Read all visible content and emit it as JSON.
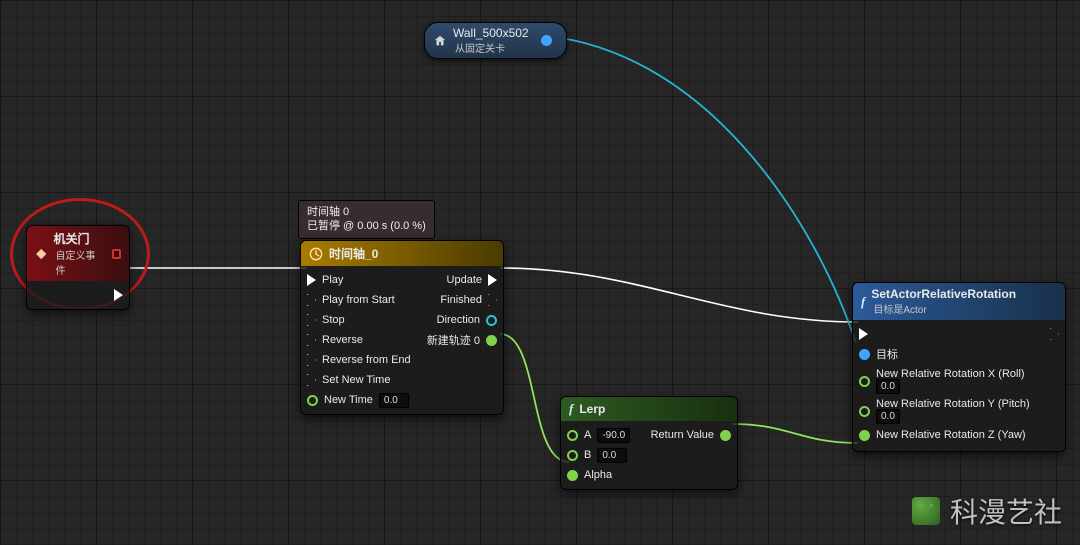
{
  "colors": {
    "exec_wire": "#ffffff",
    "float_wire": "#8fe35a",
    "object_wire": "#26b3d4"
  },
  "wall_ref": {
    "title": "Wall_500x502",
    "subtitle": "从固定关卡"
  },
  "red_annotation": true,
  "custom_event": {
    "title": "机关门",
    "subtitle": "自定义事件"
  },
  "timeline_tooltip": {
    "line1": "时间轴 0",
    "line2": "已暂停 @ 0.00 s (0.0 %)"
  },
  "timeline": {
    "title": "时间轴_0",
    "inputs": {
      "play": "Play",
      "play_from_start": "Play from Start",
      "stop": "Stop",
      "reverse": "Reverse",
      "reverse_from_end": "Reverse from End",
      "set_new_time": "Set New Time",
      "new_time": "New Time",
      "new_time_value": "0.0"
    },
    "outputs": {
      "update": "Update",
      "finished": "Finished",
      "direction": "Direction",
      "track0": "新建轨迹 0"
    }
  },
  "lerp": {
    "title": "Lerp",
    "a_label": "A",
    "a_value": "-90.0",
    "b_label": "B",
    "b_value": "0.0",
    "alpha_label": "Alpha",
    "return_label": "Return Value"
  },
  "set_rot": {
    "title": "SetActorRelativeRotation",
    "subtitle": "目标是Actor",
    "target_label": "目标",
    "roll_label": "New Relative Rotation X (Roll)",
    "roll_value": "0.0",
    "pitch_label": "New Relative Rotation Y (Pitch)",
    "pitch_value": "0.0",
    "yaw_label": "New Relative Rotation Z (Yaw)"
  },
  "watermark": "科漫艺社"
}
